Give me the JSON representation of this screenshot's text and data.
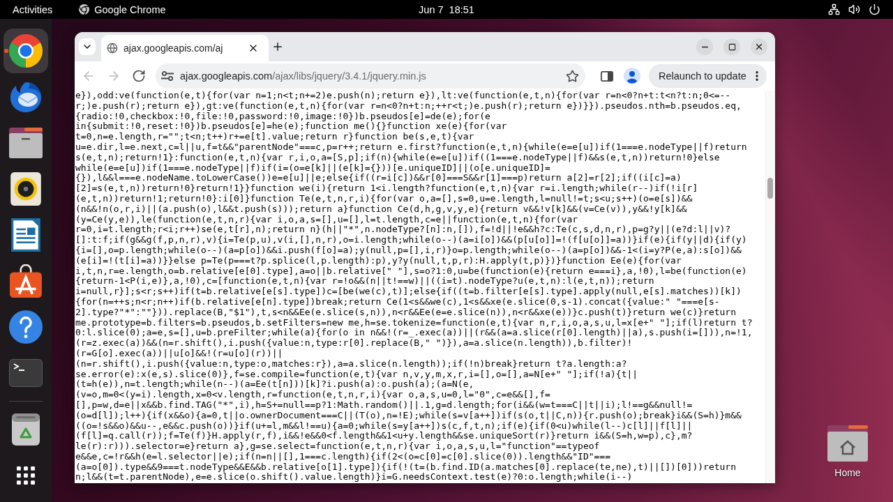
{
  "top_bar": {
    "activities": "Activities",
    "app_menu": "Google Chrome",
    "clock": "Jun 7  18:51"
  },
  "dock": {
    "apps": [
      {
        "kind": "browser",
        "selected": true,
        "running": true
      },
      {
        "kind": "mail",
        "selected": false,
        "running": false
      },
      {
        "kind": "files",
        "selected": false,
        "running": false
      },
      {
        "kind": "music",
        "selected": false,
        "running": false
      },
      {
        "kind": "writer",
        "selected": false,
        "running": false
      },
      {
        "kind": "software",
        "selected": false,
        "running": false
      },
      {
        "kind": "help",
        "selected": false,
        "running": false
      },
      {
        "kind": "terminal",
        "selected": false,
        "running": false
      }
    ],
    "system": [
      {
        "kind": "trash"
      },
      {
        "kind": "app-grid"
      }
    ]
  },
  "browser": {
    "tabs": [
      {
        "title": "ajax.googleapis.com/aj",
        "selected": true
      }
    ],
    "nav": [
      {
        "kind": "back",
        "disabled": true
      },
      {
        "kind": "forward",
        "disabled": true
      },
      {
        "kind": "reload",
        "disabled": false
      }
    ],
    "address": {
      "host": "ajax.googleapis.com",
      "path": "/ajax/libs/jquery/3.4.1/jquery.min.js"
    },
    "relaunch_button": "Relaunch to update",
    "code_lines": [
      "e}),odd:ve(function(e,t){for(var n=1;n<t;n+=2)e.push(n);return e}),lt:ve(function(e,t,n){for(var r=n<0?n+t:t<n?t:n;0<=--",
      "r;)e.push(r);return e}),gt:ve(function(e,t,n){for(var r=n<0?n+t:n;++r<t;)e.push(r);return e})}}).pseudos.nth=b.pseudos.eq,",
      "{radio:!0,checkbox:!0,file:!0,password:!0,image:!0})b.pseudos[e]=de(e);for(e",
      "in{submit:!0,reset:!0})b.pseudos[e]=he(e);function me(){}function xe(e){for(var",
      "t=0,n=e.length,r=\"\";t<n;t++)r+=e[t].value;return r}function be(s,e,t){var",
      "u=e.dir,l=e.next,c=l||u,f=t&&\"parentNode\"===c,p=r++;return e.first?function(e,t,n){while(e=e[u])if(1===e.nodeType||f)return",
      "s(e,t,n);return!1}:function(e,t,n){var r,i,o,a=[S,p];if(n){while(e=e[u])if((1===e.nodeType||f)&&s(e,t,n))return!0}else",
      "while(e=e[u])if(1===e.nodeType||f)if(i=(o=e[k]||(e[k]={}))[e.uniqueID]||(o[e.uniqueID]=",
      "{}),l&&l===e.nodeName.toLowerCase())e=e[u]||e;else{if((r=i[c])&&r[0]===S&&r[1]===p)return a[2]=r[2];if((i[c]=a)",
      "[2]=s(e,t,n))return!0}return!1}}function we(i){return 1<i.length?function(e,t,n){var r=i.length;while(r--)if(!i[r]",
      "(e,t,n))return!1;return!0}:i[0]}function Te(e,t,n,r,i){for(var o,a=[],s=0,u=e.length,l=null!=t;s<u;s++)(o=e[s])&&",
      "(n&&!n(o,r,i)||(a.push(o),l&&t.push(s)));return a}function Ce(d,h,g,v,y,e){return v&&!v[k]&&(v=Ce(v)),y&&!y[k]&&",
      "(y=Ce(y,e)),le(function(e,t,n,r){var i,o,a,s=[],u=[],l=t.length,c=e||function(e,t,n){for(var",
      "r=0,i=t.length;r<i;r++)se(e,t[r],n);return n}(h||\"*\",n.nodeType?[n]:n,[]),f=!d||!e&&h?c:Te(c,s,d,n,r),p=g?y||(e?d:l||v)?",
      "[]:t:f;if(g&&g(f,p,n,r),v){i=Te(p,u),v(i,[],n,r),o=i.length;while(o--)(a=i[o])&&(p[u[o]]=!(f[u[o]]=a))}if(e){if(y||d){if(y)",
      "{i=[],o=p.length;while(o--)(a=p[o])&&i.push(f[o]=a);y(null,p=[],i,r)}o=p.length;while(o--)(a=p[o])&&-1<(i=y?P(e,a):s[o])&&",
      "(e[i]=!(t[i]=a))}}else p=Te(p===t?p.splice(l,p.length):p),y?y(null,t,p,r):H.apply(t,p)})}function Ee(e){for(var",
      "i,t,n,r=e.length,o=b.relative[e[0].type],a=o||b.relative[\" \"],s=o?1:0,u=be(function(e){return e===i},a,!0),l=be(function(e)",
      "{return-1<P(i,e)},a,!0),c=[function(e,t,n){var r=!o&&(n||t!==w)||((i=t).nodeType?u(e,t,n):l(e,t,n));return",
      "i=null,r}];s<r;s++)if(t=b.relative[e[s].type])c=[be(we(c),t)];else{if((t=b.filter[e[s].type].apply(null,e[s].matches))[k])",
      "{for(n=++s;n<r;n++)if(b.relative[e[n].type])break;return Ce(1<s&&we(c),1<s&&xe(e.slice(0,s-1).concat({value:\" \"===e[s-",
      "2].type?\"*\":\"\"})).replace(B,\"$1\"),t,s<n&&Ee(e.slice(s,n)),n<r&&Ee(e=e.slice(n)),n<r&&xe(e))}c.push(t)}return we(c)}return",
      "me.prototype=b.filters=b.pseudos,b.setFilters=new me,h=se.tokenize=function(e,t){var n,r,i,o,a,s,u,l=x[e+\" \"];if(l)return t?",
      "0:l.slice(0);a=e,s=[],u=b.preFilter;while(a){for(o in n&&!(r=_.exec(a))||(r&&(a=a.slice(r[0].length)||a),s.push(i=[])),n=!1,",
      "(r=z.exec(a))&&(n=r.shift(),i.push({value:n,type:r[0].replace(B,\" \")}),a=a.slice(n.length)),b.filter)!",
      "(r=G[o].exec(a))||u[o]&&!(r=u[o](r))||",
      "(n=r.shift(),i.push({value:n,type:o,matches:r}),a=a.slice(n.length));if(!n)break}return t?a.length:a?",
      "se.error(e):x(e,s).slice(0)},f=se.compile=function(e,t){var n,v,y,m,x,r,i=[],o=[],a=N[e+\" \"];if(!a){t||",
      "(t=h(e)),n=t.length;while(n--)(a=Ee(t[n]))[k]?i.push(a):o.push(a);(a=N(e,",
      "(v=o,m=0<(y=i).length,x=0<v.length,r=function(e,t,n,r,i){var o,a,s,u=0,l=\"0\",c=e&&[],f=",
      "[],p=w,d=e||x&&b.find.TAG(\"*\",i),h=S+=null==p?1:Math.random()||.1,g=d.length;for(i&&(w=t===C||t||i);l!==g&&null!=",
      "(o=d[l]);l++){if(x&&o){a=0,t||o.ownerDocument===C||(T(o),n=!E);while(s=v[a++])if(s(o,t||C,n)){r.push(o);break}i&&(S=h)}m&&",
      "((o=!s&&o)&&u--,e&&c.push(o))}if(u+=l,m&&l!==u){a=0;while(s=y[a++])s(c,f,t,n);if(e){if(0<u)while(l--)c[l]||f[l]||",
      "(f[l]=q.call(r));f=Te(f)}H.apply(r,f),i&&!e&&0<f.length&&1<u+y.length&&se.uniqueSort(r)}return i&&(S=h,w=p),c},m?",
      "le(r):r))).selector=e}return a},g=se.select=function(e,t,n,r){var i,o,a,s,u,l=\"function\"==typeof",
      "e&&e,c=!r&&h(e=l.selector||e);if(n=n||[],1===c.length){if(2<(o=c[0]=c[0].slice(0)).length&&\"ID\"===",
      "(a=o[0]).type&&9===t.nodeType&&E&&b.relative[o[1].type]){if(!(t=(b.find.ID(a.matches[0].replace(te,ne),t)||[])[0]))return",
      "n;l&&(t=t.parentNode),e=e.slice(o.shift().value.length)}i=G.needsContext.test(e)?0:o.length;while(i--)"
    ]
  },
  "desktop_icons": [
    {
      "label": "Home"
    }
  ]
}
